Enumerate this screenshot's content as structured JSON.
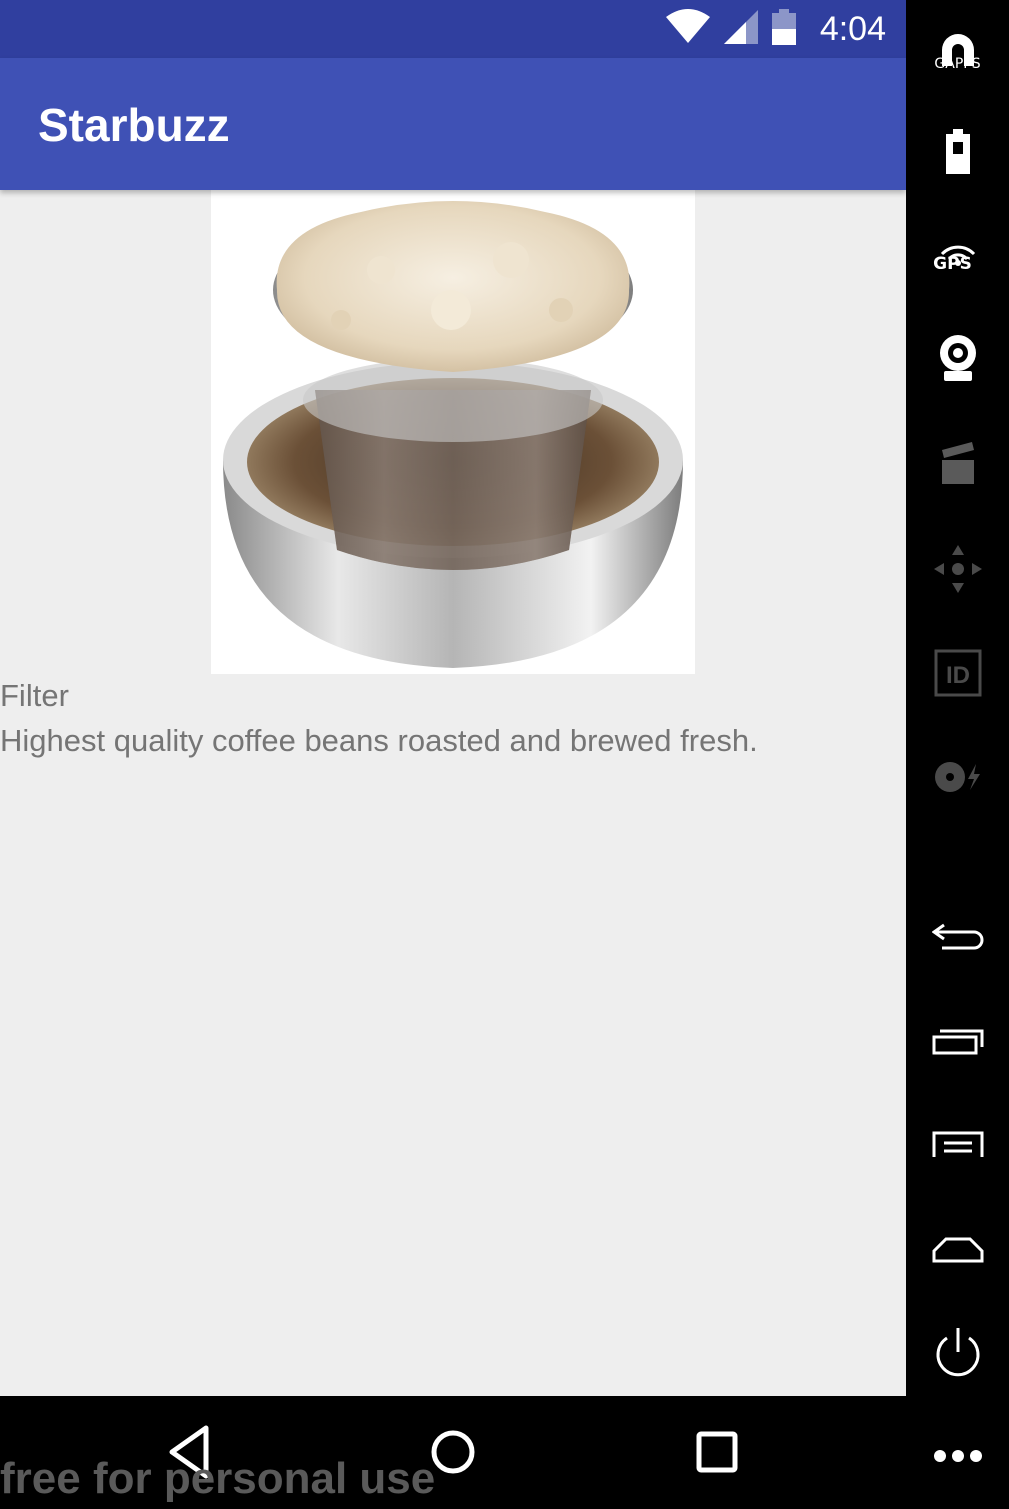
{
  "status_bar": {
    "time": "4:04",
    "icons": [
      "wifi-icon",
      "cell-signal-icon",
      "battery-icon"
    ]
  },
  "app_bar": {
    "title": "Starbuzz"
  },
  "drink": {
    "name": "Filter",
    "description": "Highest quality coffee beans roasted and brewed fresh.",
    "image": "filter-coffee-photo"
  },
  "nav_bar": {
    "buttons": [
      "back-icon",
      "home-icon",
      "recents-icon"
    ]
  },
  "watermark": "free for personal use",
  "side_panel": {
    "gapps_label": "GAPPS",
    "gps_label": "GPS",
    "buttons": [
      "gapps-icon",
      "battery-icon",
      "gps-icon",
      "camera-icon",
      "media-icon",
      "dpad-icon",
      "id-icon",
      "disk-icon",
      "back-icon",
      "recents-icon",
      "menu-icon",
      "home-icon",
      "power-icon",
      "more-icon"
    ]
  }
}
